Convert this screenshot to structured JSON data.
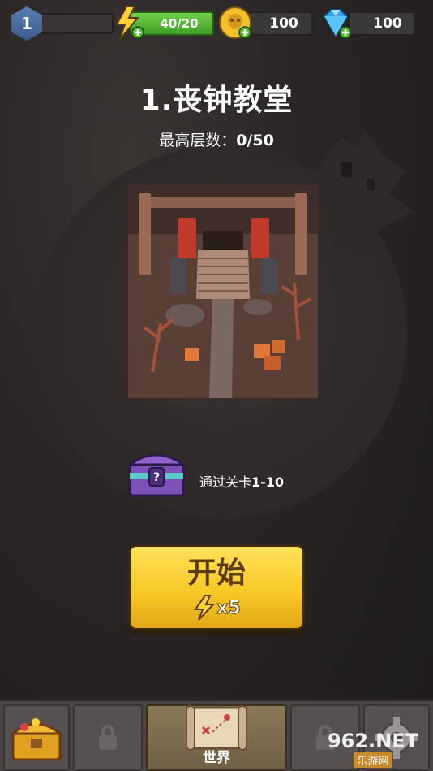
{
  "topbar": {
    "level": "1",
    "energy": "40/20",
    "coins": "100",
    "gems": "100"
  },
  "stage": {
    "title": "1.丧钟教堂",
    "highest_label": "最高层数：",
    "highest_value": "0/50"
  },
  "reward": {
    "text": "通过关卡",
    "levels": "1-10"
  },
  "start_button": {
    "label": "开始",
    "cost": "x5"
  },
  "bottom_nav": {
    "world_label": "世界"
  },
  "watermark": {
    "main": "962.NET",
    "sub": "乐游网"
  },
  "colors": {
    "accent_yellow": "#f6c623",
    "energy_green": "#4fb82e",
    "gem_blue": "#3aa0f0",
    "coin_gold": "#f2c12b"
  }
}
